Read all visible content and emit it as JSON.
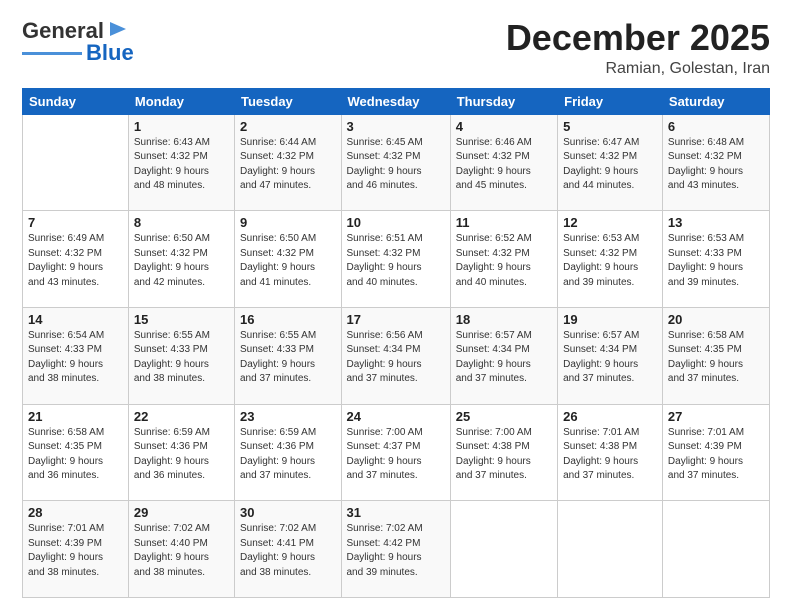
{
  "logo": {
    "line1": "General",
    "line2": "Blue"
  },
  "header": {
    "month": "December 2025",
    "location": "Ramian, Golestan, Iran"
  },
  "days_of_week": [
    "Sunday",
    "Monday",
    "Tuesday",
    "Wednesday",
    "Thursday",
    "Friday",
    "Saturday"
  ],
  "weeks": [
    [
      {
        "day": "",
        "info": ""
      },
      {
        "day": "1",
        "info": "Sunrise: 6:43 AM\nSunset: 4:32 PM\nDaylight: 9 hours\nand 48 minutes."
      },
      {
        "day": "2",
        "info": "Sunrise: 6:44 AM\nSunset: 4:32 PM\nDaylight: 9 hours\nand 47 minutes."
      },
      {
        "day": "3",
        "info": "Sunrise: 6:45 AM\nSunset: 4:32 PM\nDaylight: 9 hours\nand 46 minutes."
      },
      {
        "day": "4",
        "info": "Sunrise: 6:46 AM\nSunset: 4:32 PM\nDaylight: 9 hours\nand 45 minutes."
      },
      {
        "day": "5",
        "info": "Sunrise: 6:47 AM\nSunset: 4:32 PM\nDaylight: 9 hours\nand 44 minutes."
      },
      {
        "day": "6",
        "info": "Sunrise: 6:48 AM\nSunset: 4:32 PM\nDaylight: 9 hours\nand 43 minutes."
      }
    ],
    [
      {
        "day": "7",
        "info": "Sunrise: 6:49 AM\nSunset: 4:32 PM\nDaylight: 9 hours\nand 43 minutes."
      },
      {
        "day": "8",
        "info": "Sunrise: 6:50 AM\nSunset: 4:32 PM\nDaylight: 9 hours\nand 42 minutes."
      },
      {
        "day": "9",
        "info": "Sunrise: 6:50 AM\nSunset: 4:32 PM\nDaylight: 9 hours\nand 41 minutes."
      },
      {
        "day": "10",
        "info": "Sunrise: 6:51 AM\nSunset: 4:32 PM\nDaylight: 9 hours\nand 40 minutes."
      },
      {
        "day": "11",
        "info": "Sunrise: 6:52 AM\nSunset: 4:32 PM\nDaylight: 9 hours\nand 40 minutes."
      },
      {
        "day": "12",
        "info": "Sunrise: 6:53 AM\nSunset: 4:32 PM\nDaylight: 9 hours\nand 39 minutes."
      },
      {
        "day": "13",
        "info": "Sunrise: 6:53 AM\nSunset: 4:33 PM\nDaylight: 9 hours\nand 39 minutes."
      }
    ],
    [
      {
        "day": "14",
        "info": "Sunrise: 6:54 AM\nSunset: 4:33 PM\nDaylight: 9 hours\nand 38 minutes."
      },
      {
        "day": "15",
        "info": "Sunrise: 6:55 AM\nSunset: 4:33 PM\nDaylight: 9 hours\nand 38 minutes."
      },
      {
        "day": "16",
        "info": "Sunrise: 6:55 AM\nSunset: 4:33 PM\nDaylight: 9 hours\nand 37 minutes."
      },
      {
        "day": "17",
        "info": "Sunrise: 6:56 AM\nSunset: 4:34 PM\nDaylight: 9 hours\nand 37 minutes."
      },
      {
        "day": "18",
        "info": "Sunrise: 6:57 AM\nSunset: 4:34 PM\nDaylight: 9 hours\nand 37 minutes."
      },
      {
        "day": "19",
        "info": "Sunrise: 6:57 AM\nSunset: 4:34 PM\nDaylight: 9 hours\nand 37 minutes."
      },
      {
        "day": "20",
        "info": "Sunrise: 6:58 AM\nSunset: 4:35 PM\nDaylight: 9 hours\nand 37 minutes."
      }
    ],
    [
      {
        "day": "21",
        "info": "Sunrise: 6:58 AM\nSunset: 4:35 PM\nDaylight: 9 hours\nand 36 minutes."
      },
      {
        "day": "22",
        "info": "Sunrise: 6:59 AM\nSunset: 4:36 PM\nDaylight: 9 hours\nand 36 minutes."
      },
      {
        "day": "23",
        "info": "Sunrise: 6:59 AM\nSunset: 4:36 PM\nDaylight: 9 hours\nand 37 minutes."
      },
      {
        "day": "24",
        "info": "Sunrise: 7:00 AM\nSunset: 4:37 PM\nDaylight: 9 hours\nand 37 minutes."
      },
      {
        "day": "25",
        "info": "Sunrise: 7:00 AM\nSunset: 4:38 PM\nDaylight: 9 hours\nand 37 minutes."
      },
      {
        "day": "26",
        "info": "Sunrise: 7:01 AM\nSunset: 4:38 PM\nDaylight: 9 hours\nand 37 minutes."
      },
      {
        "day": "27",
        "info": "Sunrise: 7:01 AM\nSunset: 4:39 PM\nDaylight: 9 hours\nand 37 minutes."
      }
    ],
    [
      {
        "day": "28",
        "info": "Sunrise: 7:01 AM\nSunset: 4:39 PM\nDaylight: 9 hours\nand 38 minutes."
      },
      {
        "day": "29",
        "info": "Sunrise: 7:02 AM\nSunset: 4:40 PM\nDaylight: 9 hours\nand 38 minutes."
      },
      {
        "day": "30",
        "info": "Sunrise: 7:02 AM\nSunset: 4:41 PM\nDaylight: 9 hours\nand 38 minutes."
      },
      {
        "day": "31",
        "info": "Sunrise: 7:02 AM\nSunset: 4:42 PM\nDaylight: 9 hours\nand 39 minutes."
      },
      {
        "day": "",
        "info": ""
      },
      {
        "day": "",
        "info": ""
      },
      {
        "day": "",
        "info": ""
      }
    ]
  ]
}
